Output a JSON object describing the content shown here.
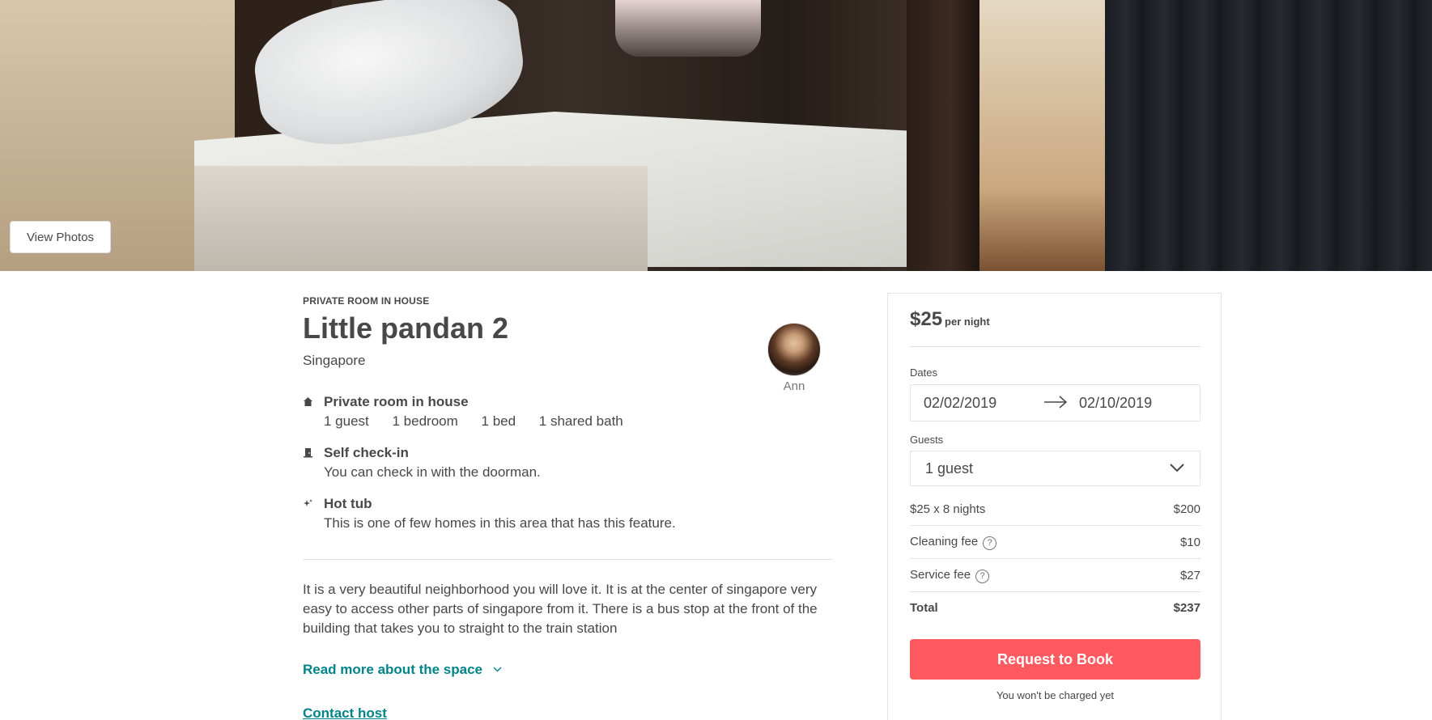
{
  "hero": {
    "view_photos_label": "View Photos"
  },
  "listing": {
    "kicker": "PRIVATE ROOM IN HOUSE",
    "title": "Little pandan 2",
    "location": "Singapore"
  },
  "host": {
    "name": "Ann"
  },
  "amenities": [
    {
      "icon": "house-icon",
      "title": "Private room in house",
      "details": [
        "1 guest",
        "1 bedroom",
        "1 bed",
        "1 shared bath"
      ]
    },
    {
      "icon": "door-icon",
      "title": "Self check-in",
      "description": "You can check in with the doorman."
    },
    {
      "icon": "sparkle-icon",
      "title": "Hot tub",
      "description": "This is one of few homes in this area that has this feature."
    }
  ],
  "description": "It is a very beautiful neighborhood you will love it. It is at the center of singapore very easy to access other parts of singapore from it. There is a bus stop at the front of the building that takes you to straight to the train station",
  "links": {
    "read_more": "Read more about the space",
    "contact_host": "Contact host"
  },
  "booking": {
    "price": "$25",
    "per_night": "per night",
    "dates_label": "Dates",
    "check_in": "02/02/2019",
    "check_out": "02/10/2019",
    "guests_label": "Guests",
    "guests_value": "1 guest",
    "fees": [
      {
        "label": "$25 x 8 nights",
        "amount": "$200",
        "info": false
      },
      {
        "label": "Cleaning fee",
        "amount": "$10",
        "info": true
      },
      {
        "label": "Service fee",
        "amount": "$27",
        "info": true
      }
    ],
    "total_label": "Total",
    "total_amount": "$237",
    "book_button": "Request to Book",
    "no_charge_note": "You won't be charged yet",
    "accent_color": "#ff5a5f"
  },
  "theme": {
    "link_color": "#008489",
    "text_color": "#484848"
  }
}
